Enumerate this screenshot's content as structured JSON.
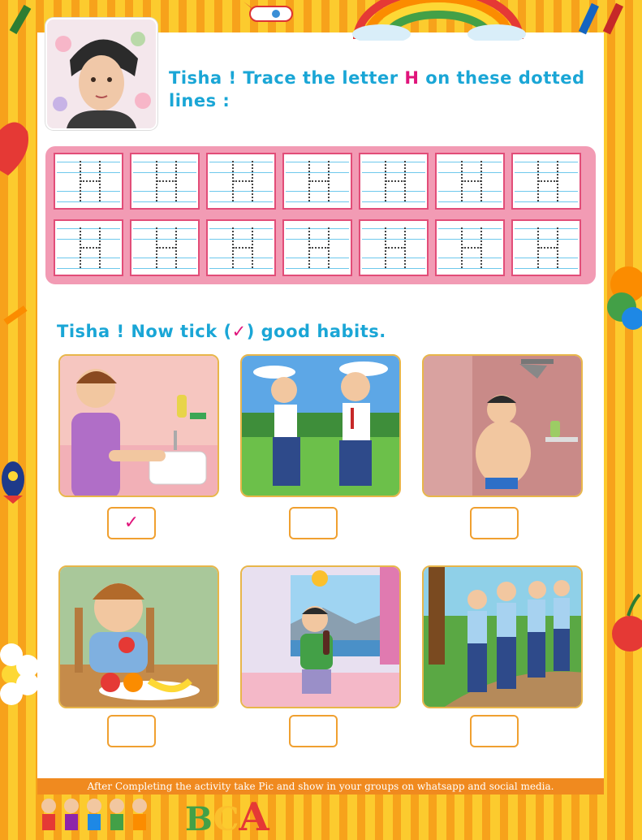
{
  "header": {
    "title_pre": "Tisha ! Trace the letter ",
    "title_letter": "H",
    "title_post": " on these dotted lines :"
  },
  "trace": {
    "letter": "H",
    "rows": 2,
    "cols": 7
  },
  "habits": {
    "title_pre": "Tisha ! Now tick (",
    "title_mark": "✓",
    "title_post": ") good habits.",
    "items": [
      {
        "scene": "boy-washing-hands",
        "checked": true
      },
      {
        "scene": "boys-fighting",
        "checked": false
      },
      {
        "scene": "boy-bathing-shower",
        "checked": false
      },
      {
        "scene": "boy-eating-fruit",
        "checked": false
      },
      {
        "scene": "boy-drinking-soda",
        "checked": false
      },
      {
        "scene": "kids-walking-to-school",
        "checked": false
      }
    ],
    "tick_glyph": "✓"
  },
  "footer": {
    "note": "After Completing the activity take Pic and show in your groups on whatsapp and social media.",
    "letters": [
      "B",
      "C",
      "A"
    ]
  },
  "colors": {
    "accent_blue": "#1aa6d6",
    "accent_pink": "#e0147b",
    "frame": "#f7a21b"
  }
}
